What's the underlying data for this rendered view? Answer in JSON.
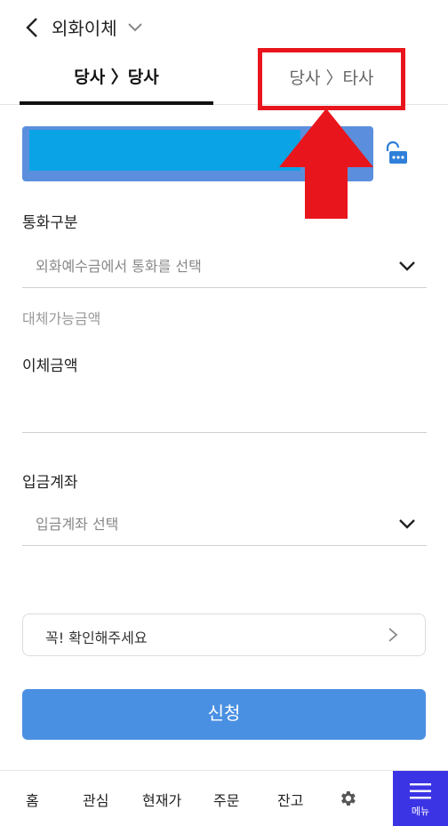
{
  "header": {
    "title": "외화이체"
  },
  "tabs": [
    {
      "label": "당사 〉당사",
      "active": true
    },
    {
      "label": "당사 〉타사",
      "active": false
    }
  ],
  "currency": {
    "label": "통화구분",
    "placeholder": "외화예수금에서 통화를 선택"
  },
  "available": {
    "label": "대체가능금액"
  },
  "amount": {
    "label": "이체금액"
  },
  "deposit": {
    "label": "입금계좌",
    "placeholder": "입금계좌 선택"
  },
  "notice": {
    "label": "꼭! 확인해주세요"
  },
  "submit": {
    "label": "신청"
  },
  "nav": {
    "items": [
      "홈",
      "관심",
      "현재가",
      "주문",
      "잔고"
    ],
    "menu_label": "메뉴"
  },
  "icons": {
    "back": "chevron-left-icon",
    "title_dropdown": "chevron-down-icon",
    "lock": "unlock-icon",
    "settings": "gear-icon",
    "menu": "hamburger-icon"
  },
  "colors": {
    "primary_button": "#4a90e2",
    "account_box": "#5b8fdd",
    "account_mask": "#0aa3e6",
    "highlight": "#e8161c",
    "menu_button": "#3b34e5"
  }
}
